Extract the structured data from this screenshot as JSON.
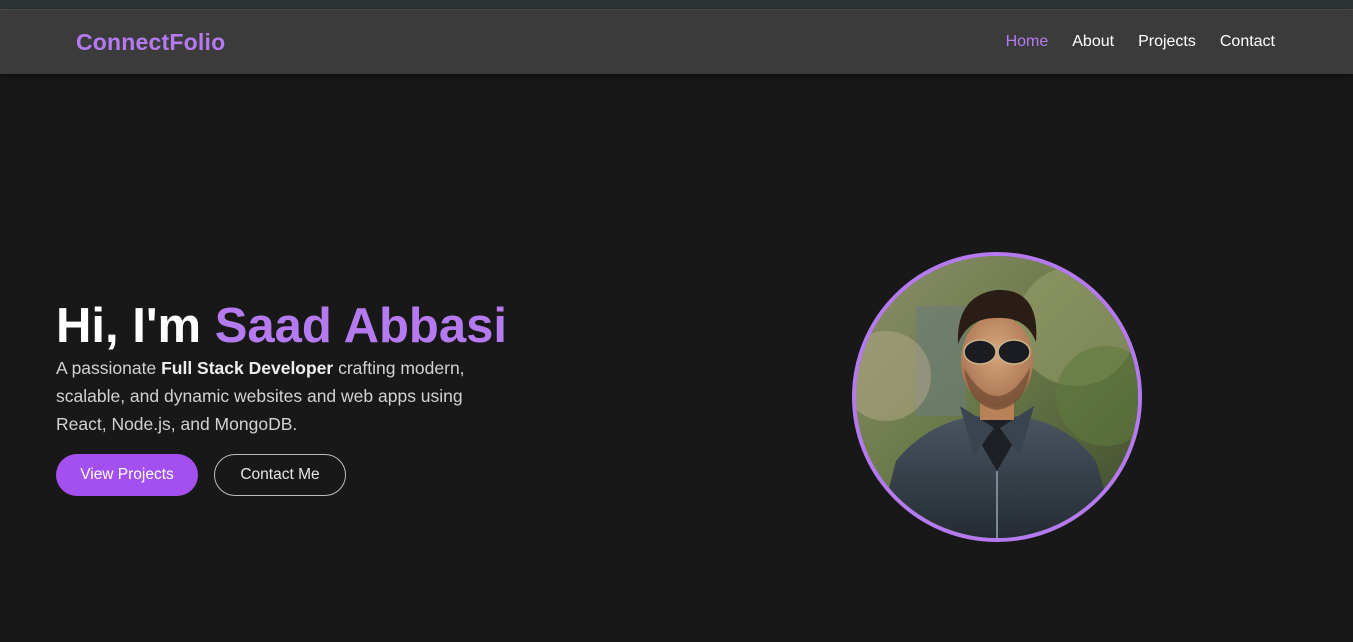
{
  "brand": {
    "name": "ConnectFolio"
  },
  "nav": {
    "items": [
      {
        "label": "Home",
        "active": true
      },
      {
        "label": "About",
        "active": false
      },
      {
        "label": "Projects",
        "active": false
      },
      {
        "label": "Contact",
        "active": false
      }
    ]
  },
  "hero": {
    "greeting": "Hi, I'm ",
    "name": "Saad Abbasi",
    "description_prefix": "A passionate ",
    "description_bold": "Full Stack Developer",
    "description_suffix": " crafting modern, scalable, and dynamic websites and web apps using React, Node.js, and MongoDB.",
    "primary_button": "View Projects",
    "secondary_button": "Contact Me"
  },
  "theme": {
    "accent": "#b57af0",
    "button_primary": "#a450f0",
    "background": "#181818",
    "navbar": "#3b3b3b"
  }
}
